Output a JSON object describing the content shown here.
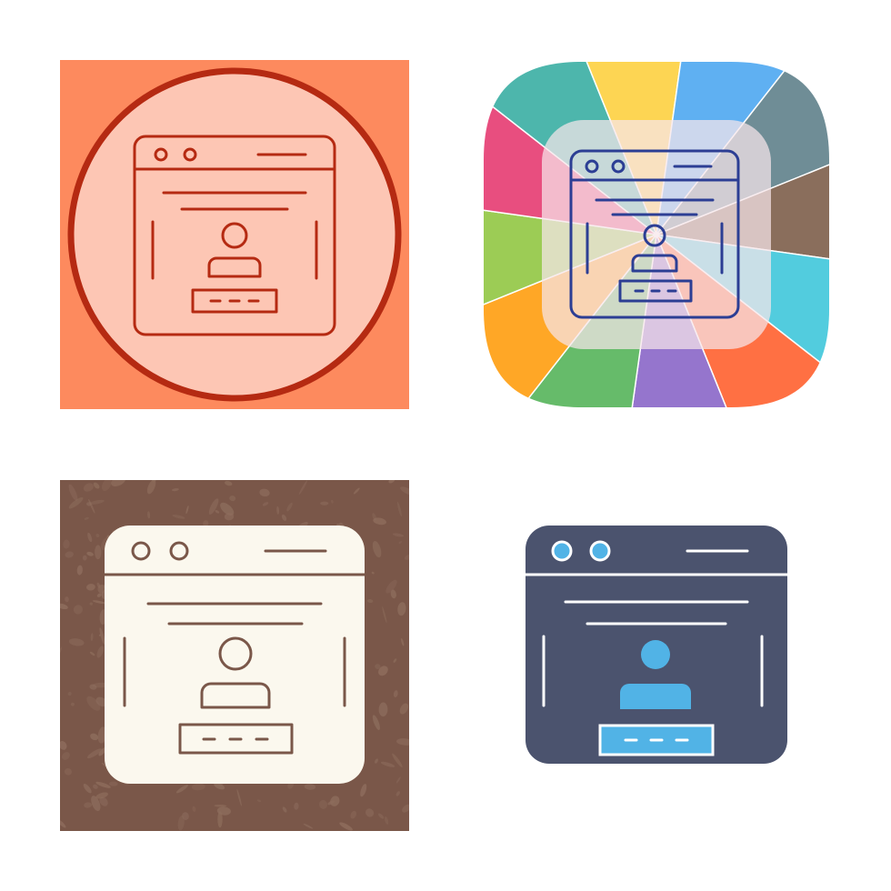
{
  "sheet": {
    "subject": "browser-login-icon",
    "variants": [
      {
        "style": "lineal-circle",
        "icon": "browser-user-login-icon",
        "colors": {
          "background": "#fd8a5e",
          "circle_fill": "#fdc6b4",
          "circle_stroke": "#b52a12",
          "line": "#b52a12"
        }
      },
      {
        "style": "lineal-multicolor",
        "icon": "browser-user-login-icon",
        "colors": {
          "segments": [
            "#fdd553",
            "#5fb0f2",
            "#6f8d96",
            "#8a6e5c",
            "#52ccde",
            "#ff7043",
            "#9575cd",
            "#66bb6a",
            "#ffa726",
            "#9ccc55",
            "#e84e7f",
            "#4db6ac"
          ],
          "inner_fill": "#f6e6ea",
          "line": "#2c3e94"
        }
      },
      {
        "style": "glyph-grunge",
        "icon": "browser-user-login-icon",
        "colors": {
          "background": "#7a5749",
          "speckle": "#8e6d5d",
          "glyph": "#fbf8ee",
          "line": "#7a5749"
        }
      },
      {
        "style": "glyph-flat",
        "icon": "browser-user-login-icon",
        "colors": {
          "window": "#4b536e",
          "accent": "#51b3e6",
          "line": "#ffffff"
        }
      }
    ]
  }
}
